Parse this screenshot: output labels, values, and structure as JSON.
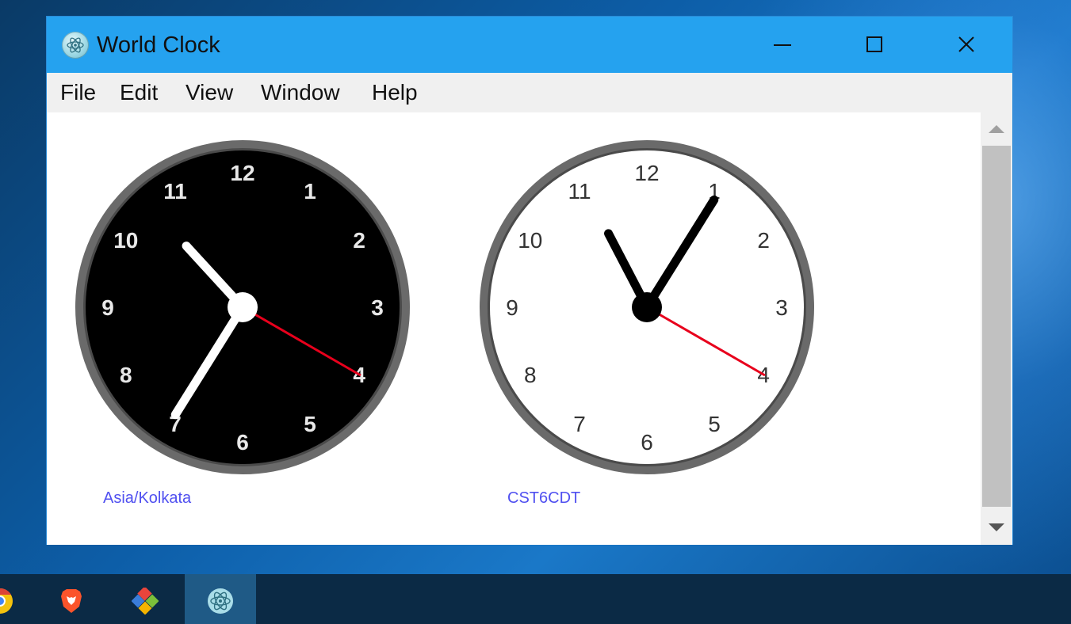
{
  "window": {
    "title": "World Clock",
    "app_icon": "electron-atom-icon",
    "controls": [
      "minimize-icon",
      "maximize-icon",
      "close-icon"
    ]
  },
  "menu": {
    "items": [
      "File",
      "Edit",
      "View",
      "Window",
      "Help"
    ]
  },
  "clocks": [
    {
      "timezone_label": "Asia/Kolkata",
      "theme": "dark",
      "face_color": "#000000",
      "numeral_color": "#e8e8e8",
      "hand_color": "#ffffff",
      "second_hand_color": "#e8001c",
      "numerals": [
        "12",
        "1",
        "2",
        "3",
        "4",
        "5",
        "6",
        "7",
        "8",
        "9",
        "10",
        "11"
      ],
      "time": {
        "hour": 10,
        "minute": 35,
        "second": 20
      }
    },
    {
      "timezone_label": "CST6CDT",
      "theme": "light",
      "face_color": "#ffffff",
      "numeral_color": "#333333",
      "hand_color": "#000000",
      "second_hand_color": "#e8001c",
      "numerals": [
        "12",
        "1",
        "2",
        "3",
        "4",
        "5",
        "6",
        "7",
        "8",
        "9",
        "10",
        "11"
      ],
      "time": {
        "hour": 11,
        "minute": 5,
        "second": 20
      }
    }
  ],
  "taskbar": {
    "items": [
      "chrome-icon",
      "brave-browser-icon",
      "git-extensions-icon",
      "electron-app-icon"
    ],
    "active_item": "electron-app-icon"
  },
  "colors": {
    "titlebar": "#25a2ef",
    "menubar": "#f0f0f0",
    "label_link": "#5050f0",
    "bezel": "#6a6a6a"
  }
}
